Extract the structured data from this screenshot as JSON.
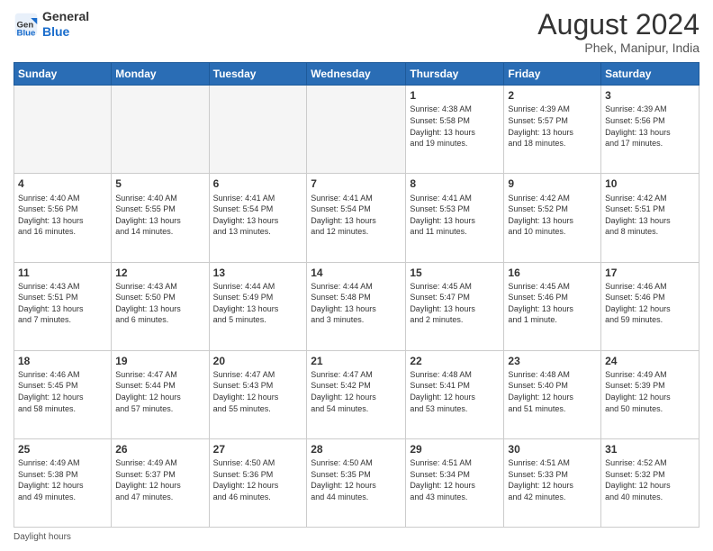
{
  "header": {
    "logo_general": "General",
    "logo_blue": "Blue",
    "month_year": "August 2024",
    "location": "Phek, Manipur, India"
  },
  "days_of_week": [
    "Sunday",
    "Monday",
    "Tuesday",
    "Wednesday",
    "Thursday",
    "Friday",
    "Saturday"
  ],
  "footer": {
    "label": "Daylight hours"
  },
  "weeks": [
    [
      {
        "day": "",
        "info": ""
      },
      {
        "day": "",
        "info": ""
      },
      {
        "day": "",
        "info": ""
      },
      {
        "day": "",
        "info": ""
      },
      {
        "day": "1",
        "info": "Sunrise: 4:38 AM\nSunset: 5:58 PM\nDaylight: 13 hours\nand 19 minutes."
      },
      {
        "day": "2",
        "info": "Sunrise: 4:39 AM\nSunset: 5:57 PM\nDaylight: 13 hours\nand 18 minutes."
      },
      {
        "day": "3",
        "info": "Sunrise: 4:39 AM\nSunset: 5:56 PM\nDaylight: 13 hours\nand 17 minutes."
      }
    ],
    [
      {
        "day": "4",
        "info": "Sunrise: 4:40 AM\nSunset: 5:56 PM\nDaylight: 13 hours\nand 16 minutes."
      },
      {
        "day": "5",
        "info": "Sunrise: 4:40 AM\nSunset: 5:55 PM\nDaylight: 13 hours\nand 14 minutes."
      },
      {
        "day": "6",
        "info": "Sunrise: 4:41 AM\nSunset: 5:54 PM\nDaylight: 13 hours\nand 13 minutes."
      },
      {
        "day": "7",
        "info": "Sunrise: 4:41 AM\nSunset: 5:54 PM\nDaylight: 13 hours\nand 12 minutes."
      },
      {
        "day": "8",
        "info": "Sunrise: 4:41 AM\nSunset: 5:53 PM\nDaylight: 13 hours\nand 11 minutes."
      },
      {
        "day": "9",
        "info": "Sunrise: 4:42 AM\nSunset: 5:52 PM\nDaylight: 13 hours\nand 10 minutes."
      },
      {
        "day": "10",
        "info": "Sunrise: 4:42 AM\nSunset: 5:51 PM\nDaylight: 13 hours\nand 8 minutes."
      }
    ],
    [
      {
        "day": "11",
        "info": "Sunrise: 4:43 AM\nSunset: 5:51 PM\nDaylight: 13 hours\nand 7 minutes."
      },
      {
        "day": "12",
        "info": "Sunrise: 4:43 AM\nSunset: 5:50 PM\nDaylight: 13 hours\nand 6 minutes."
      },
      {
        "day": "13",
        "info": "Sunrise: 4:44 AM\nSunset: 5:49 PM\nDaylight: 13 hours\nand 5 minutes."
      },
      {
        "day": "14",
        "info": "Sunrise: 4:44 AM\nSunset: 5:48 PM\nDaylight: 13 hours\nand 3 minutes."
      },
      {
        "day": "15",
        "info": "Sunrise: 4:45 AM\nSunset: 5:47 PM\nDaylight: 13 hours\nand 2 minutes."
      },
      {
        "day": "16",
        "info": "Sunrise: 4:45 AM\nSunset: 5:46 PM\nDaylight: 13 hours\nand 1 minute."
      },
      {
        "day": "17",
        "info": "Sunrise: 4:46 AM\nSunset: 5:46 PM\nDaylight: 12 hours\nand 59 minutes."
      }
    ],
    [
      {
        "day": "18",
        "info": "Sunrise: 4:46 AM\nSunset: 5:45 PM\nDaylight: 12 hours\nand 58 minutes."
      },
      {
        "day": "19",
        "info": "Sunrise: 4:47 AM\nSunset: 5:44 PM\nDaylight: 12 hours\nand 57 minutes."
      },
      {
        "day": "20",
        "info": "Sunrise: 4:47 AM\nSunset: 5:43 PM\nDaylight: 12 hours\nand 55 minutes."
      },
      {
        "day": "21",
        "info": "Sunrise: 4:47 AM\nSunset: 5:42 PM\nDaylight: 12 hours\nand 54 minutes."
      },
      {
        "day": "22",
        "info": "Sunrise: 4:48 AM\nSunset: 5:41 PM\nDaylight: 12 hours\nand 53 minutes."
      },
      {
        "day": "23",
        "info": "Sunrise: 4:48 AM\nSunset: 5:40 PM\nDaylight: 12 hours\nand 51 minutes."
      },
      {
        "day": "24",
        "info": "Sunrise: 4:49 AM\nSunset: 5:39 PM\nDaylight: 12 hours\nand 50 minutes."
      }
    ],
    [
      {
        "day": "25",
        "info": "Sunrise: 4:49 AM\nSunset: 5:38 PM\nDaylight: 12 hours\nand 49 minutes."
      },
      {
        "day": "26",
        "info": "Sunrise: 4:49 AM\nSunset: 5:37 PM\nDaylight: 12 hours\nand 47 minutes."
      },
      {
        "day": "27",
        "info": "Sunrise: 4:50 AM\nSunset: 5:36 PM\nDaylight: 12 hours\nand 46 minutes."
      },
      {
        "day": "28",
        "info": "Sunrise: 4:50 AM\nSunset: 5:35 PM\nDaylight: 12 hours\nand 44 minutes."
      },
      {
        "day": "29",
        "info": "Sunrise: 4:51 AM\nSunset: 5:34 PM\nDaylight: 12 hours\nand 43 minutes."
      },
      {
        "day": "30",
        "info": "Sunrise: 4:51 AM\nSunset: 5:33 PM\nDaylight: 12 hours\nand 42 minutes."
      },
      {
        "day": "31",
        "info": "Sunrise: 4:52 AM\nSunset: 5:32 PM\nDaylight: 12 hours\nand 40 minutes."
      }
    ]
  ]
}
